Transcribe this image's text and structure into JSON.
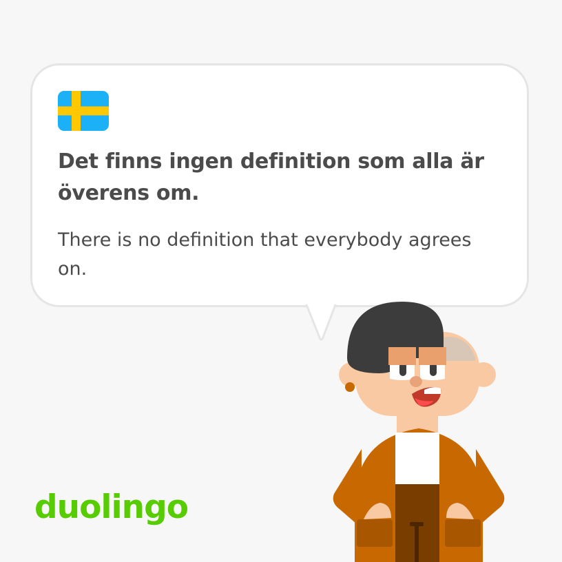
{
  "card": {
    "flag_icon": "sweden-flag-icon",
    "sentence": "Det finns ingen definition som alla är överens om.",
    "translation": "There is no definition that everybody agrees on."
  },
  "brand": {
    "logo_text": "duolingo",
    "logo_color": "#58cc02"
  },
  "colors": {
    "background": "#f7f7f7",
    "bubble_fill": "#ffffff",
    "bubble_border": "#e5e5e5",
    "text": "#4b4b4b",
    "flag_blue": "#1cb0f6",
    "flag_yellow": "#ffc800",
    "jacket": "#c76800",
    "skin": "#f9c9a3",
    "hair": "#3c3c3c"
  },
  "illustration": {
    "character_icon": "character-illustration"
  }
}
